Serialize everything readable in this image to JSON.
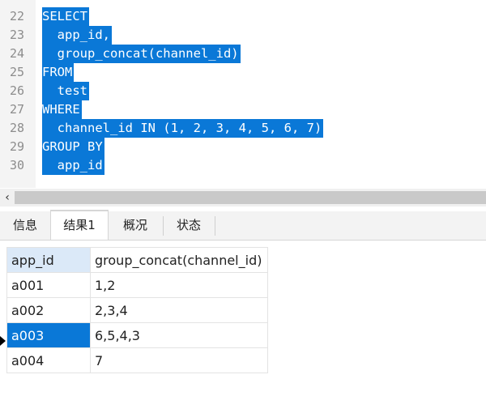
{
  "editor": {
    "lines": [
      {
        "no": "22",
        "code": "SELECT"
      },
      {
        "no": "23",
        "code": "  app_id,"
      },
      {
        "no": "24",
        "code": "  group_concat(channel_id)"
      },
      {
        "no": "25",
        "code": "FROM"
      },
      {
        "no": "26",
        "code": "  test"
      },
      {
        "no": "27",
        "code": "WHERE"
      },
      {
        "no": "28",
        "code": "  channel_id IN (1, 2, 3, 4, 5, 6, 7)"
      },
      {
        "no": "29",
        "code": "GROUP BY"
      },
      {
        "no": "30",
        "code": "  app_id"
      }
    ],
    "selection_color": "#0a78d7"
  },
  "scrollbar": {
    "left_arrow": "‹"
  },
  "tabs": [
    {
      "label": "信息",
      "active": false
    },
    {
      "label": "结果1",
      "active": true
    },
    {
      "label": "概况",
      "active": false
    },
    {
      "label": "状态",
      "active": false
    }
  ],
  "results": {
    "columns": [
      "app_id",
      "group_concat(channel_id)"
    ],
    "rows": [
      [
        "a001",
        "1,2"
      ],
      [
        "a002",
        "2,3,4"
      ],
      [
        "a003",
        "6,5,4,3"
      ],
      [
        "a004",
        "7"
      ]
    ],
    "selected_row": 2
  }
}
